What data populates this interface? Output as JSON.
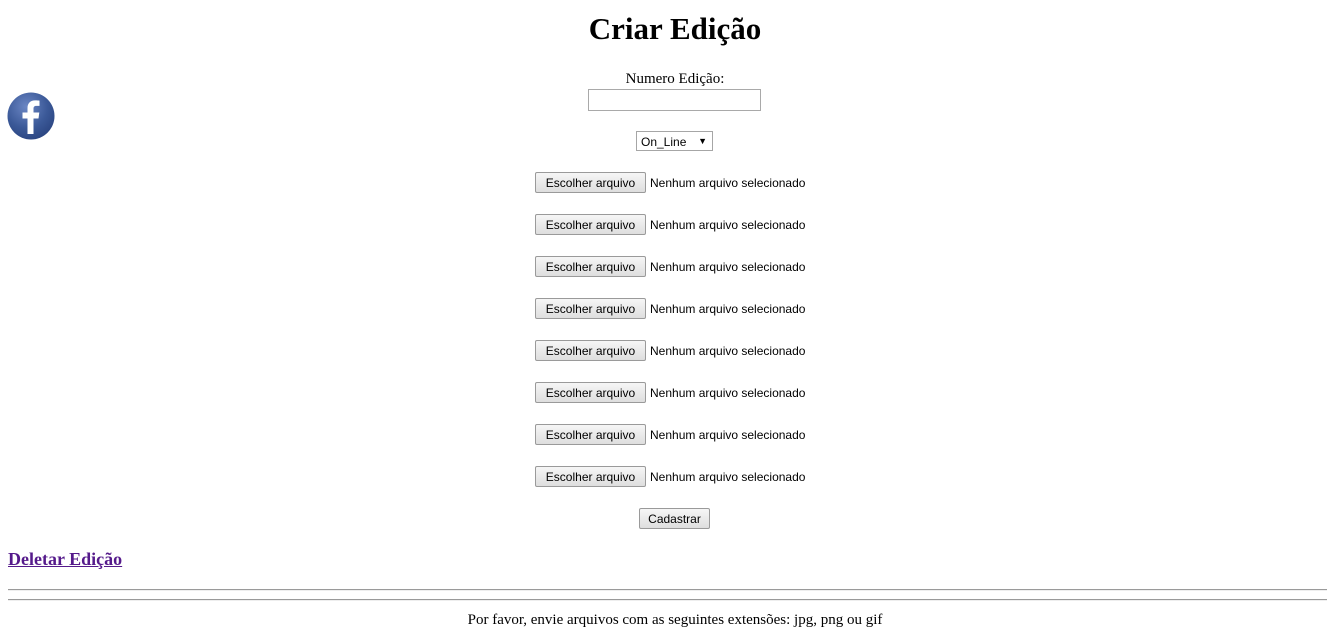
{
  "page": {
    "title": "Criar Edição"
  },
  "form": {
    "number_label": "Numero Edição:",
    "number_value": "",
    "type_select": {
      "selected": "On_Line"
    },
    "file_inputs": [
      {
        "button_label": "Escolher arquivo",
        "status": "Nenhum arquivo selecionado"
      },
      {
        "button_label": "Escolher arquivo",
        "status": "Nenhum arquivo selecionado"
      },
      {
        "button_label": "Escolher arquivo",
        "status": "Nenhum arquivo selecionado"
      },
      {
        "button_label": "Escolher arquivo",
        "status": "Nenhum arquivo selecionado"
      },
      {
        "button_label": "Escolher arquivo",
        "status": "Nenhum arquivo selecionado"
      },
      {
        "button_label": "Escolher arquivo",
        "status": "Nenhum arquivo selecionado"
      },
      {
        "button_label": "Escolher arquivo",
        "status": "Nenhum arquivo selecionado"
      },
      {
        "button_label": "Escolher arquivo",
        "status": "Nenhum arquivo selecionado"
      }
    ],
    "submit_label": "Cadastrar"
  },
  "links": {
    "delete_label": "Deletar Edição"
  },
  "footer": {
    "note": "Por favor, envie arquivos com as seguintes extensões: jpg, png ou gif"
  },
  "icons": {
    "social": "facebook-icon"
  },
  "colors": {
    "facebook_blue": "#3b5998",
    "visited_link": "#551a8b"
  }
}
